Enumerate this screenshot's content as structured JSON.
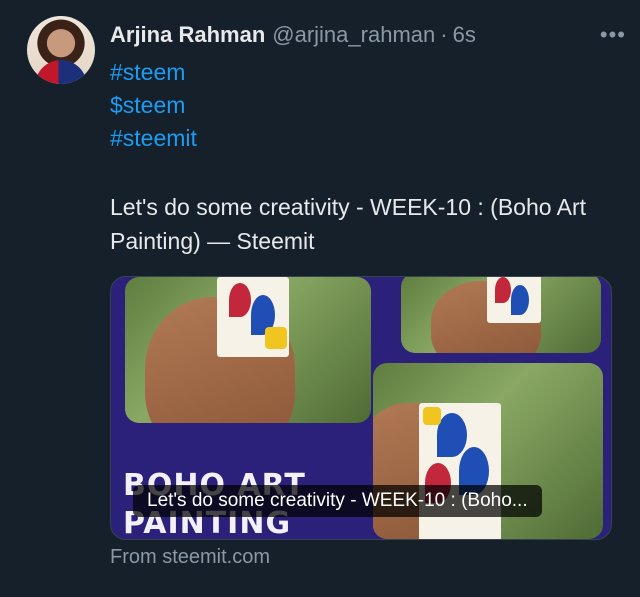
{
  "author": {
    "name": "Arjina Rahman",
    "handle": "@arjina_rahman",
    "separator": "·",
    "time": "6s"
  },
  "more_icon": "•••",
  "tags": [
    "#steem",
    "$steem",
    "#steemit"
  ],
  "post_text": "Let's do some creativity - WEEK-10 : (Boho Art Painting) — Steemit",
  "link_card": {
    "image_text_line1": "BOHO ART",
    "image_text_line2": "PAINTING",
    "title": "Let's do some creativity - WEEK-10 : (Boho...",
    "source": "From steemit.com"
  },
  "colors": {
    "background": "#15202b",
    "link": "#1d9bf0",
    "muted": "#8b98a5",
    "card_bg": "#2b207a"
  }
}
